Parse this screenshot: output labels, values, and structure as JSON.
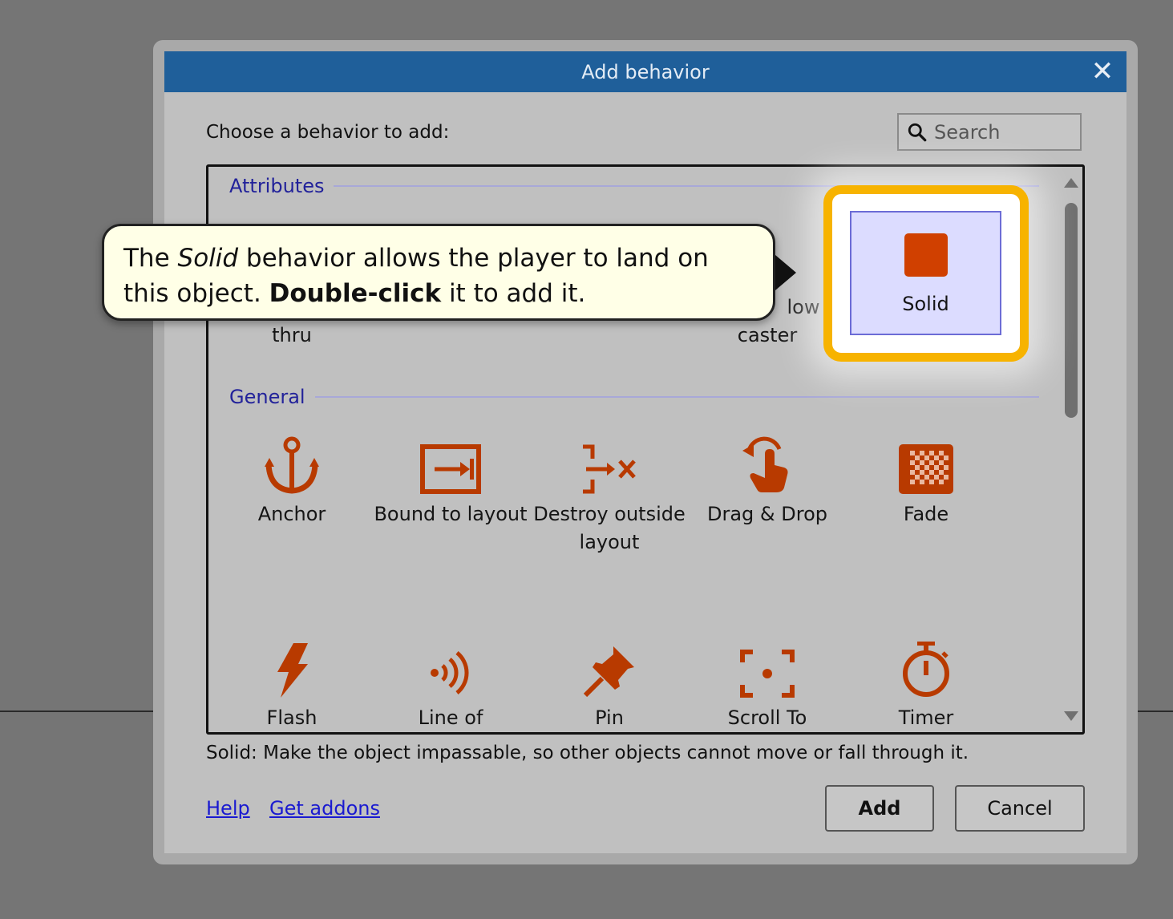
{
  "dialog": {
    "title": "Add behavior",
    "close_glyph": "✕",
    "prompt": "Choose a behavior to add:",
    "search": {
      "placeholder": "Search",
      "icon": "search-icon"
    }
  },
  "sections": [
    {
      "label": "Attributes",
      "items": [
        {
          "label": "thru",
          "icon": "jump-thru-icon"
        },
        {
          "label": "caster",
          "icon": "shadow-caster-icon"
        },
        {
          "label": "Solid",
          "icon": "solid-icon",
          "selected": true
        }
      ],
      "partial_text": "low"
    },
    {
      "label": "General",
      "items": [
        {
          "label": "Anchor",
          "icon": "anchor-icon"
        },
        {
          "label": "Bound to layout",
          "icon": "bound-to-layout-icon"
        },
        {
          "label": "Destroy outside layout",
          "icon": "destroy-outside-layout-icon"
        },
        {
          "label": "Drag & Drop",
          "icon": "drag-drop-icon"
        },
        {
          "label": "Fade",
          "icon": "fade-icon"
        },
        {
          "label": "Flash",
          "icon": "flash-icon"
        },
        {
          "label": "Line of",
          "icon": "line-of-sight-icon"
        },
        {
          "label": "Pin",
          "icon": "pin-icon"
        },
        {
          "label": "Scroll To",
          "icon": "scroll-to-icon"
        },
        {
          "label": "Timer",
          "icon": "timer-icon"
        }
      ]
    }
  ],
  "tooltip": {
    "pre": "The ",
    "em": "Solid",
    "mid": " behavior allows the player to land on this object. ",
    "strong": "Double-click",
    "post": " it to add it."
  },
  "description": "Solid: Make the object impassable, so other objects cannot move or fall through it.",
  "footer": {
    "help_link": "Help",
    "addons_link": "Get addons",
    "add_button": "Add",
    "cancel_button": "Cancel"
  },
  "colors": {
    "titlebar": "#1f5f9a",
    "icon": "#b83a00",
    "solid_square": "#d04000",
    "highlight": "#f7b300",
    "section_label": "#22229a"
  }
}
